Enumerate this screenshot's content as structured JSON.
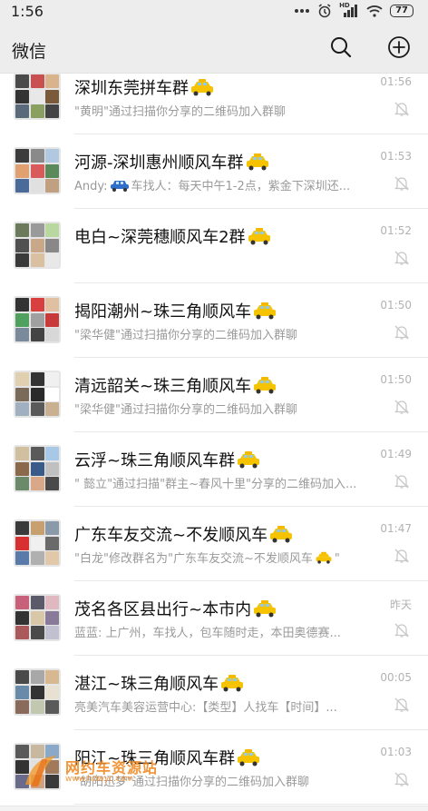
{
  "status_bar": {
    "time": "1:56",
    "battery": "77",
    "network": "HD"
  },
  "header": {
    "title": "微信"
  },
  "chats": [
    {
      "name": "深圳东莞拼车群",
      "time": "01:56",
      "preview": "\"黄明\"通过扫描你分享的二维码加入群聊"
    },
    {
      "name": "河源-深圳惠州顺风车群",
      "time": "01:53",
      "preview_prefix": "Andy:",
      "preview": "车找人：每天中午1-2点，紫金下深圳还..."
    },
    {
      "name": "电白~深莞穗顺风车2群",
      "time": "01:52",
      "preview": ""
    },
    {
      "name": "揭阳潮州~珠三角顺风车",
      "time": "01:50",
      "preview": "\"梁华健\"通过扫描你分享的二维码加入群聊"
    },
    {
      "name": "清远韶关~珠三角顺风车",
      "time": "01:50",
      "preview": "\"梁华健\"通过扫描你分享的二维码加入群聊"
    },
    {
      "name": "云浮~珠三角顺风车群",
      "time": "01:49",
      "preview": "\" 懿立\"通过扫描\"群主~春风十里\"分享的二维码加入..."
    },
    {
      "name": "广东车友交流~不发顺风车",
      "time": "01:47",
      "preview": "\"白龙\"修改群名为\"广东车友交流~不发顺风车",
      "preview_suffix": "\""
    },
    {
      "name": "茂名各区县出行~本市内",
      "time": "昨天",
      "preview": "蓝蓝: 上广州，车找人，包车随时走，本田奥德赛..."
    },
    {
      "name": "湛江~珠三角顺风车",
      "time": "00:05",
      "preview": "亮美汽车美容运营中心:【类型】人找车【时间】..."
    },
    {
      "name": "阳江~珠三角顺风车群",
      "time": "01:03",
      "preview": "\"胡阳迅梦\"通过扫描你分享的二维码加入群聊"
    }
  ],
  "watermark": {
    "text": "网约车资源站",
    "url": "www.hdwyc.com"
  },
  "icons": {
    "search": "search-icon",
    "add": "plus-circle-icon",
    "mute": "bell-muted-icon",
    "taxi": "taxi-emoji"
  }
}
